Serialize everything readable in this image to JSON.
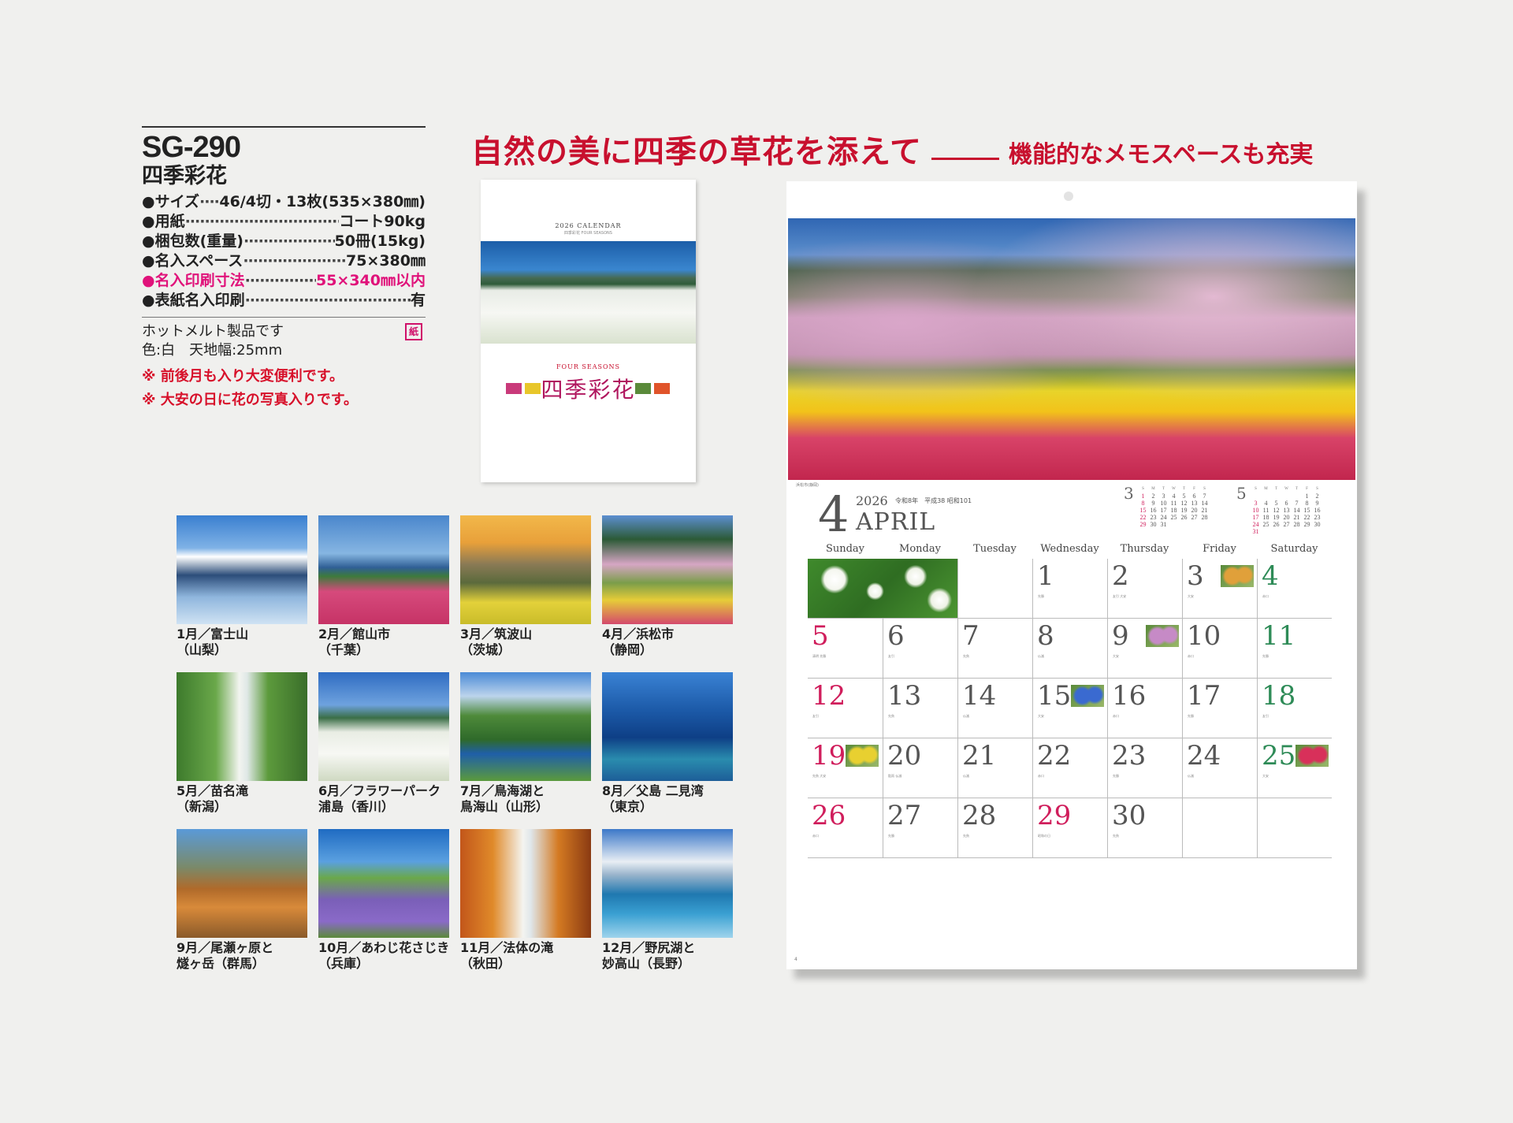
{
  "product": {
    "code": "SG-290",
    "name": "四季彩花",
    "specs": [
      {
        "label": "●サイズ",
        "value": "46/4切・13枚(535×380㎜)",
        "highlight": false
      },
      {
        "label": "●用紙",
        "value": "コート90kg",
        "highlight": false
      },
      {
        "label": "●梱包数(重量)",
        "value": "50冊(15kg)",
        "highlight": false
      },
      {
        "label": "●名入スペース",
        "value": "75×380㎜",
        "highlight": false
      },
      {
        "label": "●名入印刷寸法",
        "value": "55×340㎜以内",
        "highlight": true
      },
      {
        "label": "●表紙名入印刷",
        "value": "有",
        "highlight": false
      }
    ],
    "note1": "ホットメルト製品です",
    "note2": "色:白　天地幅:25mm",
    "badge": "紙",
    "remarks": [
      "※ 前後月も入り大変便利です。",
      "※ 大安の日に花の写真入りです。"
    ]
  },
  "headline": {
    "main": "自然の美に四季の草花を添えて",
    "sub": "機能的なメモスペースも充実"
  },
  "cover": {
    "title": "2026 CALENDAR",
    "subtitle": "四季彩花 FOUR SEASONS",
    "season": "FOUR SEASONS",
    "name": "四季彩花"
  },
  "months": [
    {
      "line1": "1月／富士山",
      "line2": "（山梨）"
    },
    {
      "line1": "2月／館山市",
      "line2": "（千葉）"
    },
    {
      "line1": "3月／筑波山",
      "line2": "（茨城）"
    },
    {
      "line1": "4月／浜松市",
      "line2": "（静岡）"
    },
    {
      "line1": "5月／苗名滝",
      "line2": "（新潟）"
    },
    {
      "line1": "6月／フラワーパーク",
      "line2": "浦島（香川）"
    },
    {
      "line1": "7月／鳥海湖と",
      "line2": "鳥海山（山形）"
    },
    {
      "line1": "8月／父島 二見湾",
      "line2": "（東京）"
    },
    {
      "line1": "9月／尾瀬ヶ原と",
      "line2": "燧ヶ岳（群馬）"
    },
    {
      "line1": "10月／あわじ花さじき",
      "line2": "（兵庫）"
    },
    {
      "line1": "11月／法体の滝",
      "line2": "（秋田）"
    },
    {
      "line1": "12月／野尻湖と",
      "line2": "妙高山（長野）"
    }
  ],
  "calendar": {
    "photo_caption": "浜松市(静岡)",
    "month_number": "4",
    "year": "2026",
    "era": "令和8年　平成38 昭和101",
    "month_name": "APRIL",
    "weekdays": [
      "Sunday",
      "Monday",
      "Tuesday",
      "Wednesday",
      "Thursday",
      "Friday",
      "Saturday"
    ],
    "days": [
      {
        "d": "",
        "sub": ""
      },
      {
        "d": "",
        "sub": ""
      },
      {
        "d": "",
        "sub": ""
      },
      {
        "d": "1",
        "sub": "先勝"
      },
      {
        "d": "2",
        "sub": "友引 大安"
      },
      {
        "d": "3",
        "sub": "大安"
      },
      {
        "d": "4",
        "sub": "赤口"
      },
      {
        "d": "5",
        "sub": "清明 先勝"
      },
      {
        "d": "6",
        "sub": "友引"
      },
      {
        "d": "7",
        "sub": "先負"
      },
      {
        "d": "8",
        "sub": "仏滅"
      },
      {
        "d": "9",
        "sub": "大安"
      },
      {
        "d": "10",
        "sub": "赤口"
      },
      {
        "d": "11",
        "sub": "先勝"
      },
      {
        "d": "12",
        "sub": "友引"
      },
      {
        "d": "13",
        "sub": "先負"
      },
      {
        "d": "14",
        "sub": "仏滅"
      },
      {
        "d": "15",
        "sub": "大安"
      },
      {
        "d": "16",
        "sub": "赤口"
      },
      {
        "d": "17",
        "sub": "先勝"
      },
      {
        "d": "18",
        "sub": "友引"
      },
      {
        "d": "19",
        "sub": "先負 大安"
      },
      {
        "d": "20",
        "sub": "穀雨 仏滅"
      },
      {
        "d": "21",
        "sub": "仏滅"
      },
      {
        "d": "22",
        "sub": "赤口"
      },
      {
        "d": "23",
        "sub": "先勝"
      },
      {
        "d": "24",
        "sub": "仏滅"
      },
      {
        "d": "25",
        "sub": "大安"
      },
      {
        "d": "26",
        "sub": "赤口"
      },
      {
        "d": "27",
        "sub": "先勝"
      },
      {
        "d": "28",
        "sub": "先負"
      },
      {
        "d": "29",
        "sub": "昭和の日"
      },
      {
        "d": "30",
        "sub": "先負"
      },
      {
        "d": "",
        "sub": ""
      },
      {
        "d": "",
        "sub": ""
      }
    ],
    "flower_days": [
      "3",
      "9",
      "15",
      "19",
      "25"
    ],
    "prev_month": {
      "num": "3",
      "rows": [
        [
          "S",
          "M",
          "T",
          "W",
          "T",
          "F",
          "S"
        ],
        [
          "1",
          "2",
          "3",
          "4",
          "5",
          "6",
          "7"
        ],
        [
          "8",
          "9",
          "10",
          "11",
          "12",
          "13",
          "14"
        ],
        [
          "15",
          "16",
          "17",
          "18",
          "19",
          "20",
          "21"
        ],
        [
          "22",
          "23",
          "24",
          "25",
          "26",
          "27",
          "28"
        ],
        [
          "29",
          "30",
          "31",
          "",
          "",
          "",
          ""
        ]
      ]
    },
    "next_month": {
      "num": "5",
      "rows": [
        [
          "S",
          "M",
          "T",
          "W",
          "T",
          "F",
          "S"
        ],
        [
          "",
          "",
          "",
          "",
          "",
          "1",
          "2"
        ],
        [
          "3",
          "4",
          "5",
          "6",
          "7",
          "8",
          "9"
        ],
        [
          "10",
          "11",
          "12",
          "13",
          "14",
          "15",
          "16"
        ],
        [
          "17",
          "18",
          "19",
          "20",
          "21",
          "22",
          "23"
        ],
        [
          "24",
          "25",
          "26",
          "27",
          "28",
          "29",
          "30"
        ],
        [
          "31",
          "",
          "",
          "",
          "",
          "",
          ""
        ]
      ]
    },
    "page_number": "4"
  },
  "colors": {
    "headline": "#c8102e",
    "highlight": "#e0127a",
    "sunday": "#d01e5c",
    "saturday": "#2e8b57"
  }
}
